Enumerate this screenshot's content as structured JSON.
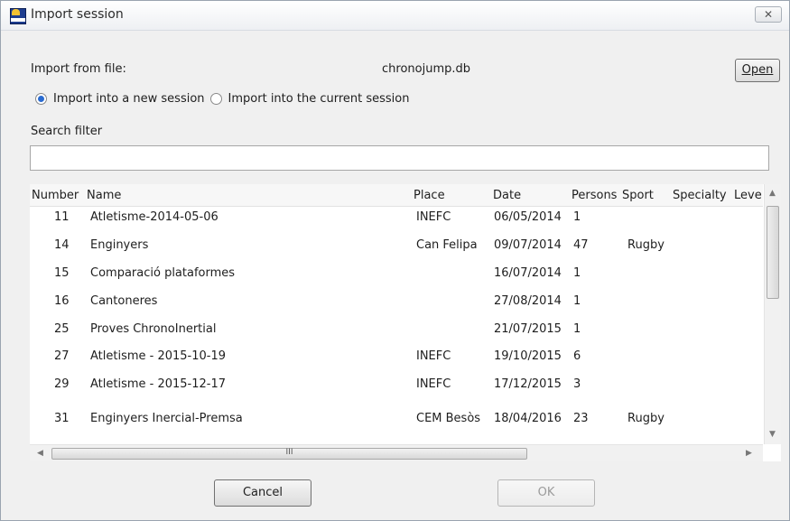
{
  "window": {
    "title": "Import session",
    "close_glyph": "✕"
  },
  "import": {
    "from_label": "Import from file:",
    "filename": "chronojump.db",
    "open_button": "Open",
    "option_new": "Import into a new session",
    "option_current": "Import into the current session",
    "selected_option": "new"
  },
  "search": {
    "label": "Search filter",
    "value": ""
  },
  "table": {
    "columns": [
      "Number",
      "Name",
      "Place",
      "Date",
      "Persons",
      "Sport",
      "Specialty",
      "Leve"
    ],
    "rows": [
      {
        "number": "11",
        "name": "Atletisme-2014-05-06",
        "place": "INEFC",
        "date": "06/05/2014",
        "persons": "1",
        "sport": "",
        "specialty": "",
        "level": ""
      },
      {
        "number": "14",
        "name": "Enginyers",
        "place": "Can Felipa",
        "date": "09/07/2014",
        "persons": "47",
        "sport": "Rugby",
        "specialty": "",
        "level": ""
      },
      {
        "number": "15",
        "name": "Comparació plataformes",
        "place": "",
        "date": "16/07/2014",
        "persons": "1",
        "sport": "",
        "specialty": "",
        "level": ""
      },
      {
        "number": "16",
        "name": "Cantoneres",
        "place": "",
        "date": "27/08/2014",
        "persons": "1",
        "sport": "",
        "specialty": "",
        "level": ""
      },
      {
        "number": "25",
        "name": "Proves ChronoInertial",
        "place": "",
        "date": "21/07/2015",
        "persons": "1",
        "sport": "",
        "specialty": "",
        "level": ""
      },
      {
        "number": "27",
        "name": "Atletisme - 2015-10-19",
        "place": "INEFC",
        "date": "19/10/2015",
        "persons": "6",
        "sport": "",
        "specialty": "",
        "level": ""
      },
      {
        "number": "29",
        "name": "Atletisme - 2015-12-17",
        "place": "INEFC",
        "date": "17/12/2015",
        "persons": "3",
        "sport": "",
        "specialty": "",
        "level": ""
      },
      {
        "number": "31",
        "name": "Enginyers Inercial-Premsa",
        "place": "CEM Besòs",
        "date": "18/04/2016",
        "persons": "23",
        "sport": "Rugby",
        "specialty": "",
        "level": ""
      }
    ],
    "scroll_grip": "III"
  },
  "buttons": {
    "cancel": "Cancel",
    "ok": "OK"
  },
  "colors": {
    "accent": "#2a6bd0",
    "window_bg": "#f0f0f0"
  },
  "icons": [
    "chronojump-app-icon",
    "close-icon",
    "scroll-up-icon",
    "scroll-down-icon",
    "scroll-left-icon",
    "scroll-right-icon"
  ]
}
